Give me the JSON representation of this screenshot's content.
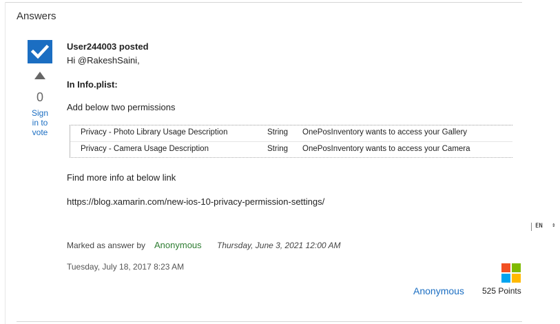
{
  "section": {
    "title": "Answers"
  },
  "vote": {
    "count": "0",
    "signin_label": "Sign in to vote",
    "icon": "triangle-up"
  },
  "answer_badge": {
    "icon": "checkmark",
    "color": "#1b6ec2"
  },
  "post": {
    "header": "User244003 posted",
    "greeting": "Hi @RakeshSaini,",
    "plist_heading": "In Info.plist:",
    "add_permissions": "Add below two permissions",
    "plist_rows": [
      {
        "key": "Privacy - Photo Library Usage Description",
        "type": "String",
        "value": "OnePosInventory wants to access your Gallery"
      },
      {
        "key": "Privacy - Camera Usage Description",
        "type": "String",
        "value": "OnePosInventory wants to access your Camera"
      }
    ],
    "more_info": "Find more info at below link",
    "link": "https://blog.xamarin.com/new-ios-10-privacy-permission-settings/"
  },
  "marked": {
    "label": "Marked as answer by",
    "user": "Anonymous",
    "date": "Thursday, June 3, 2021 12:00 AM"
  },
  "post_date": "Tuesday, July 18, 2017 8:23 AM",
  "author": {
    "name": "Anonymous",
    "points": "525 Points",
    "logo_icon": "microsoft-logo"
  },
  "language": {
    "value": "EN"
  },
  "colors": {
    "accent": "#1b6ec2",
    "marked_user": "#2e7d32"
  }
}
